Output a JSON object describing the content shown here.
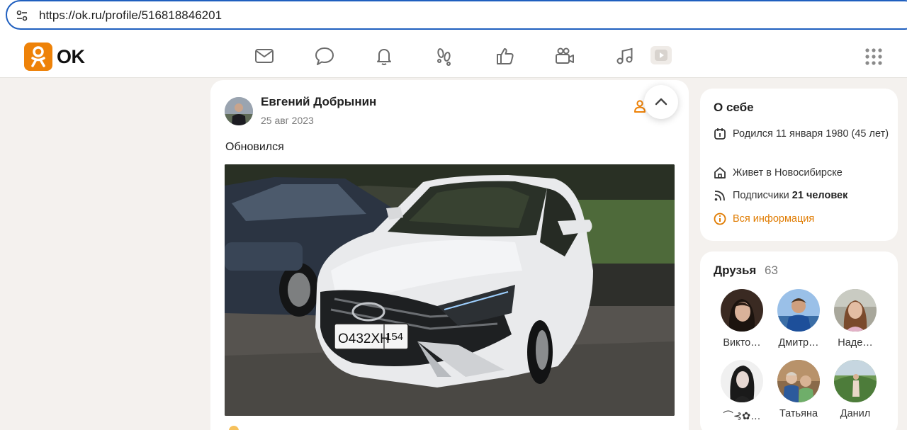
{
  "browser": {
    "url": "https://ok.ru/profile/516818846201"
  },
  "nav": {
    "logo_text": "OK",
    "icons": [
      "mail-icon",
      "chat-icon",
      "bell-icon",
      "footprints-icon",
      "like-icon",
      "video-camera-icon",
      "music-icon",
      "video-play-icon",
      "apps-grid-icon"
    ]
  },
  "post": {
    "author": "Евгений Добрынин",
    "date": "25 авг 2023",
    "text": "Обновился",
    "photo": {
      "plate_text": "О432ХН",
      "plate_region": "154"
    }
  },
  "about": {
    "title": "О себе",
    "born": "Родился 11 января 1980 (45 лет)",
    "lives": "Живет в Новосибирске",
    "subscribers_label": "Подписчики",
    "subscribers_value": "21 человек",
    "all_info": "Вся информация"
  },
  "friends": {
    "title": "Друзья",
    "count": "63",
    "list": [
      {
        "name": "Викто…"
      },
      {
        "name": "Дмитр…"
      },
      {
        "name": "Наде…"
      },
      {
        "name": "⌒⊰✿…"
      },
      {
        "name": "Татьяна"
      },
      {
        "name": "Данил"
      }
    ]
  },
  "colors": {
    "accent": "#ee8208",
    "link": "#e07b00",
    "url_border": "#1f5fbf",
    "page_bg": "#f4f1ee"
  }
}
